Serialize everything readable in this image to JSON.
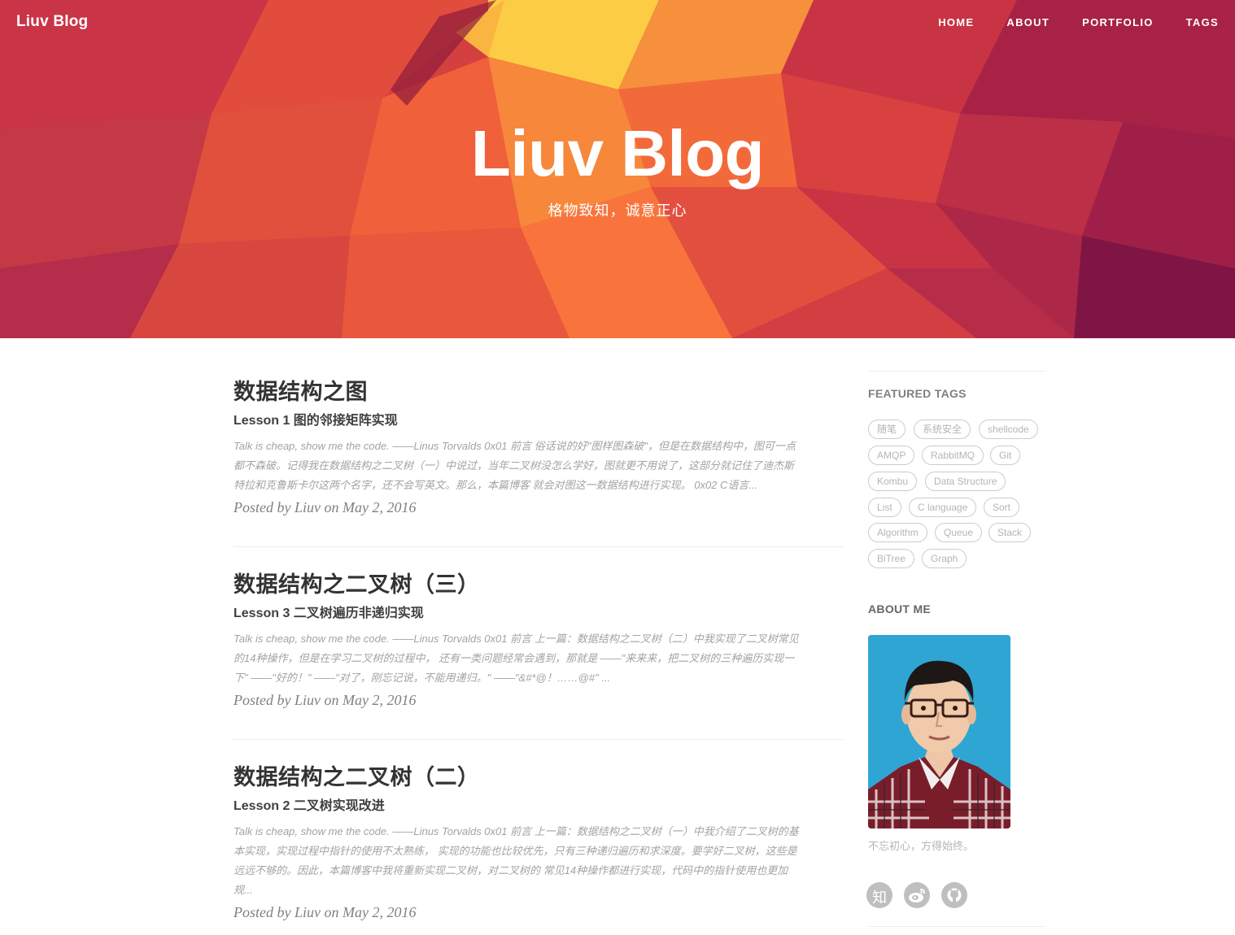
{
  "brand": "Liuv Blog",
  "nav": [
    "HOME",
    "ABOUT",
    "PORTFOLIO",
    "TAGS"
  ],
  "hero": {
    "title": "Liuv Blog",
    "subtitle": "格物致知，诚意正心"
  },
  "posts": [
    {
      "title": "数据结构之图",
      "subtitle": "Lesson 1 图的邻接矩阵实现",
      "excerpt_lines": [
        "Talk is cheap, show me the code. ——Linus Torvalds 0x01 前言 俗话说的好\"图样图森破\"，但是在数据结构中，图可一点",
        "都不森破。记得我在数据结构之二叉树（一）中说过，当年二叉树没怎么学好，图就更不用说了，这部分就记住了迪杰斯",
        "特拉和克鲁斯卡尔这两个名字，还不会写英文。那么，本篇博客 就会对图这一数据结构进行实现。 0x02 C语言..."
      ],
      "meta": "Posted by Liuv on May 2, 2016"
    },
    {
      "title": "数据结构之二叉树（三）",
      "subtitle": "Lesson 3 二叉树遍历非递归实现",
      "excerpt_lines": [
        "Talk is cheap, show me the code. ——Linus Torvalds 0x01 前言 上一篇：数据结构之二叉树（二）中我实现了二叉树常见",
        "的14种操作，但是在学习二叉树的过程中， 还有一类问题经常会遇到，那就是 ——\"来来来，把二叉树的三种遍历实现一",
        "下\" ——\"好的！\" ——\"对了，刚忘记说，不能用递归。\" ——\"&#*@！……@#\" ..."
      ],
      "meta": "Posted by Liuv on May 2, 2016"
    },
    {
      "title": "数据结构之二叉树（二）",
      "subtitle": "Lesson 2 二叉树实现改进",
      "excerpt_lines": [
        "Talk is cheap, show me the code. ——Linus Torvalds 0x01 前言 上一篇：数据结构之二叉树（一）中我介绍了二叉树的基",
        "本实现，实现过程中指针的使用不太熟练， 实现的功能也比较优先，只有三种递归遍历和求深度。要学好二叉树，这些是",
        "远远不够的。因此，本篇博客中我将重新实现二叉树，对二叉树的 常见14种操作都进行实现，代码中的指针使用也更加",
        "规..."
      ],
      "meta": "Posted by Liuv on May 2, 2016"
    }
  ],
  "sidebar": {
    "featured_heading": "FEATURED TAGS",
    "tags": [
      "随笔",
      "系统安全",
      "shellcode",
      "AMQP",
      "RabbitMQ",
      "Git",
      "Kombu",
      "Data Structure",
      "List",
      "C language",
      "Sort",
      "Algorithm",
      "Queue",
      "Stack",
      "BiTree",
      "Graph"
    ],
    "about_heading": "ABOUT ME",
    "motto": "不忘初心，方得始终。",
    "social": [
      {
        "icon": "zhihu-icon",
        "label": "知"
      },
      {
        "icon": "weibo-icon",
        "label": ""
      },
      {
        "icon": "github-icon",
        "label": ""
      }
    ]
  },
  "colors": {
    "hero_red": "#d9443f",
    "hero_orange": "#f36b3b",
    "hero_yellow": "#fcc843",
    "hero_crimson": "#a62245",
    "avatar_bg": "#2fa5d3"
  }
}
